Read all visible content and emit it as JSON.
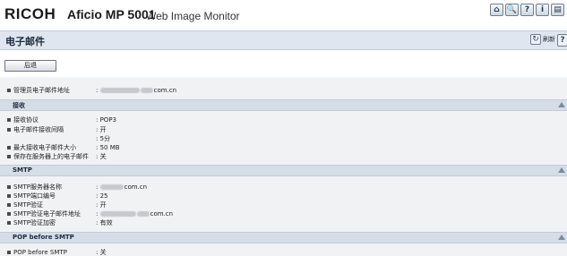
{
  "header": {
    "brand": "RICOH",
    "model": "Aficio MP 5001",
    "product": "Web Image Monitor",
    "toolbar_icons": [
      "home-icon",
      "search-icon",
      "help-icon",
      "info-icon",
      "user-icon"
    ],
    "toolbar_glyphs": [
      "⌂",
      "🔍",
      "?",
      "i",
      "▤"
    ]
  },
  "page": {
    "title": "电子邮件",
    "refresh_label": "刷新",
    "help_glyph": "?"
  },
  "actions": {
    "back_label": "后退"
  },
  "admin": {
    "label": "管理员电子邮件地址",
    "value_prefix": ":",
    "value_suffix": "com.cn"
  },
  "receive_section": {
    "title": "接收",
    "rows": [
      {
        "label": "接收协议",
        "value": ": POP3"
      },
      {
        "label": "电子邮件接收间隔",
        "value": ": 开"
      },
      {
        "label": "",
        "value": ": 5分"
      },
      {
        "label": "最大接收电子邮件大小",
        "value": ": 50 MB"
      },
      {
        "label": "保存在服务器上的电子邮件",
        "value": ": 关"
      }
    ]
  },
  "smtp_section": {
    "title": "SMTP",
    "rows": [
      {
        "label": "SMTP服务器名称",
        "value_suffix": "com.cn"
      },
      {
        "label": "SMTP端口编号",
        "value": ": 25"
      },
      {
        "label": "SMTP验证",
        "value": ": 开"
      },
      {
        "label": "SMTP验证电子邮件地址",
        "value_suffix": "com.cn"
      },
      {
        "label": "SMTP验证加密",
        "value": ": 有效"
      }
    ]
  },
  "pop_section": {
    "title": "POP before SMTP",
    "rows": [
      {
        "label": "POP before SMTP",
        "value": ": 关"
      }
    ]
  },
  "colors": {
    "section_bg": "#d5dde7",
    "content_bg": "#f1f2f4",
    "titlebar_bg": "#dfe6ef"
  }
}
